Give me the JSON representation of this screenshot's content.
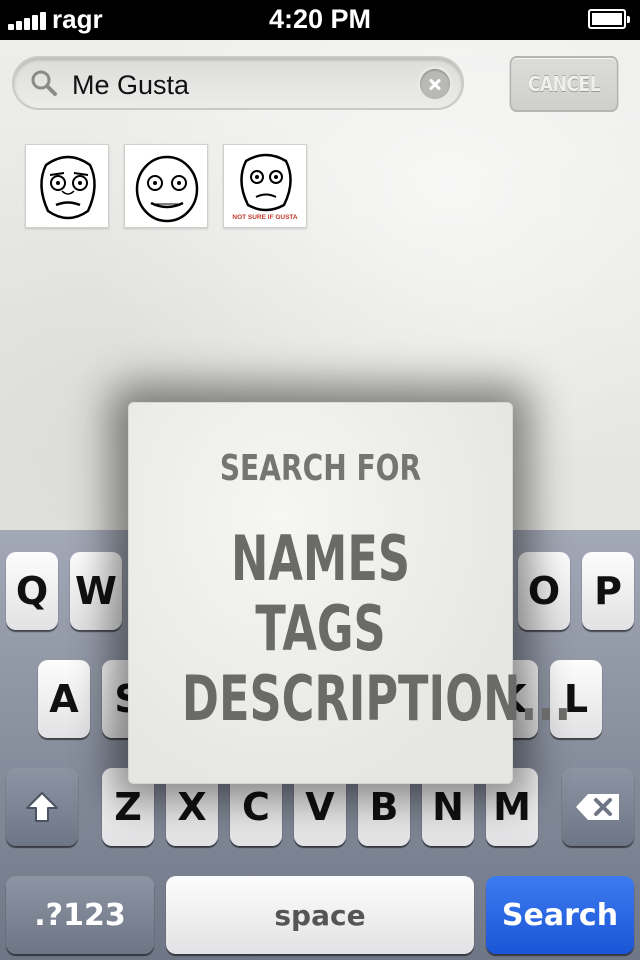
{
  "status_bar": {
    "carrier": "ragr",
    "time": "4:20 PM",
    "battery_level": 1.0
  },
  "search": {
    "query": "Me Gusta",
    "cancel_label": "CANCEL"
  },
  "results": [
    {
      "icon": "me-gusta-face",
      "caption": ""
    },
    {
      "icon": "me-gusta-face",
      "caption": ""
    },
    {
      "icon": "me-gusta-face",
      "caption": "NOT SURE IF GUSTA"
    }
  ],
  "popup": {
    "heading": "SEARCH FOR",
    "lines": [
      "NAMES",
      "TAGS",
      "DESCRIPTION..."
    ]
  },
  "keyboard": {
    "row1": [
      "Q",
      "W",
      "O",
      "P"
    ],
    "row2": [
      "A",
      "S",
      "K",
      "L"
    ],
    "row3": [
      "Z",
      "X",
      "C",
      "V",
      "B",
      "N",
      "M"
    ],
    "numbers_label": ".?123",
    "space_label": "space",
    "search_label": "Search",
    "accent_color": "#1a55d6"
  }
}
